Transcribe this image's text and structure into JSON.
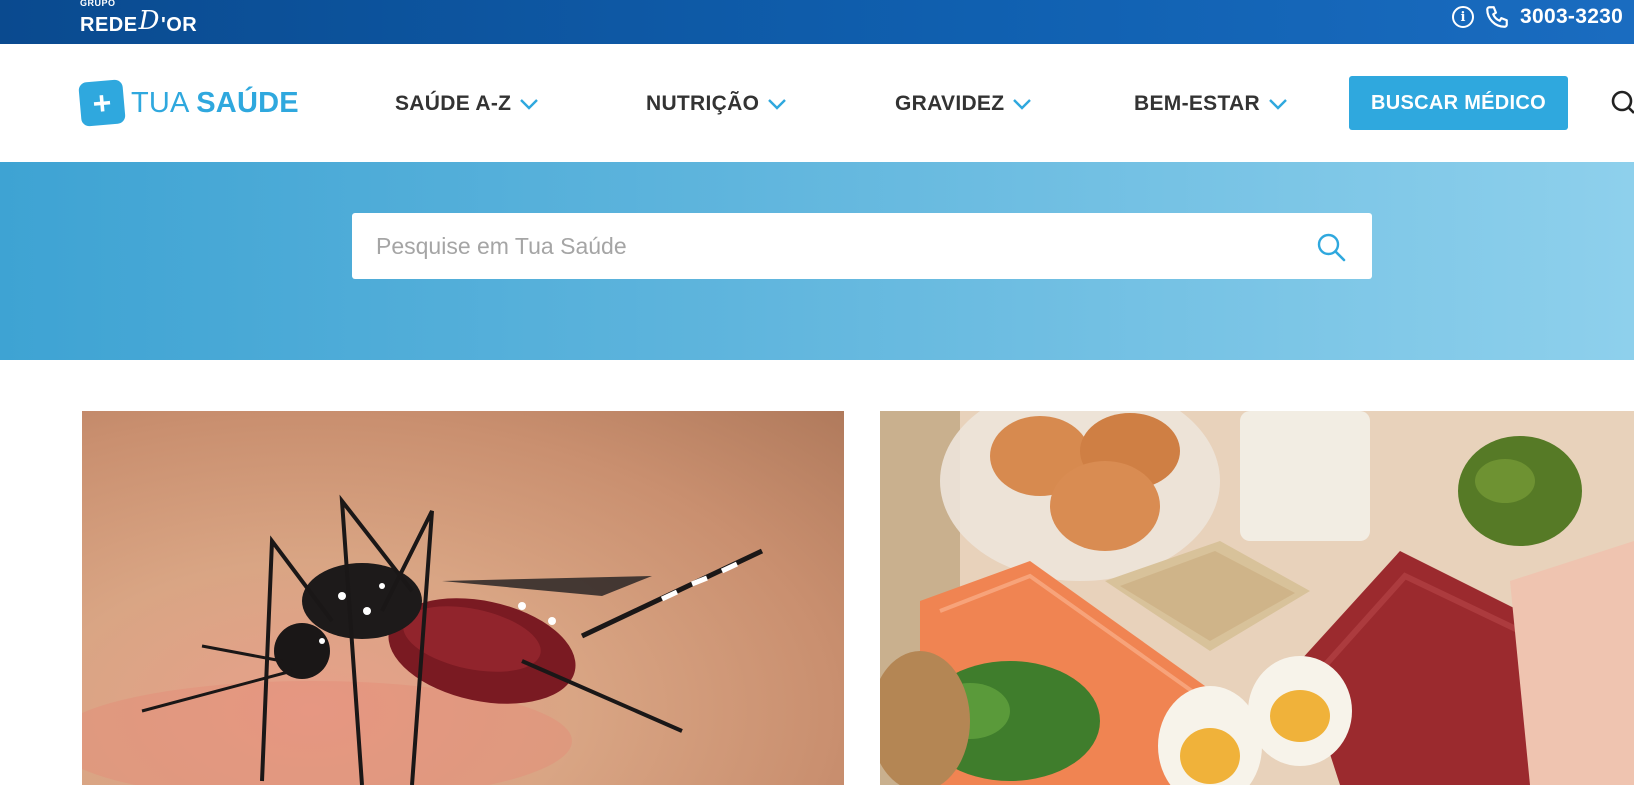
{
  "topbar": {
    "group_label": "GRUPO",
    "logo_text_left": "REDE",
    "logo_text_d": "D",
    "logo_text_right": "'OR",
    "phone": "3003-3230",
    "icons": [
      "info-icon",
      "phone-icon"
    ]
  },
  "brand": {
    "badge": "+",
    "name_light": "TUA ",
    "name_bold": "SAÚDE",
    "color": "#2fa8de"
  },
  "nav": {
    "items": [
      {
        "label": "SAÚDE A-Z"
      },
      {
        "label": "NUTRIÇÃO"
      },
      {
        "label": "GRAVIDEZ"
      },
      {
        "label": "BEM-ESTAR"
      }
    ],
    "cta_label": "BUSCAR MÉDICO",
    "search_icon": "search-icon"
  },
  "hero": {
    "search_placeholder": "Pesquise em Tua Saúde",
    "search_value": ""
  },
  "cards": [
    {
      "image": "mosquito-photo"
    },
    {
      "image": "protein-foods-photo"
    }
  ],
  "colors": {
    "topbar": "#0a4a8f",
    "accent": "#2fa8de",
    "nav_text": "#333333"
  }
}
